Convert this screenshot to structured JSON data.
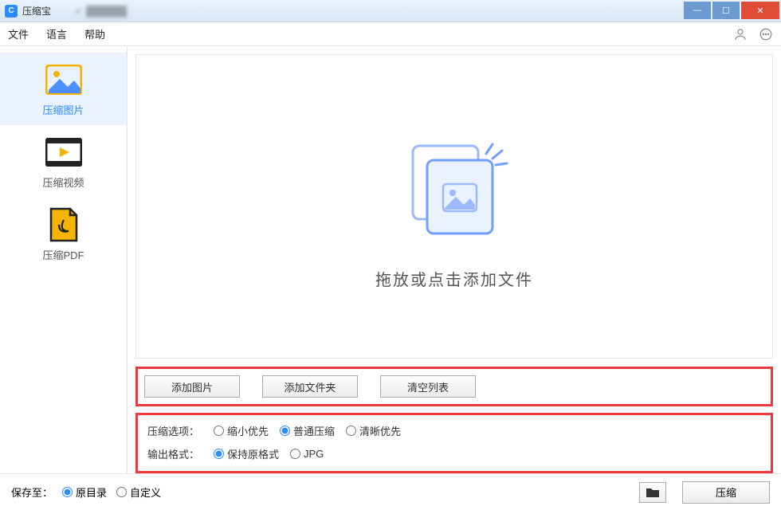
{
  "window": {
    "title": "压缩宝"
  },
  "menu": {
    "file": "文件",
    "language": "语言",
    "help": "帮助"
  },
  "sidebar": {
    "items": [
      {
        "label": "压缩图片"
      },
      {
        "label": "压缩视频"
      },
      {
        "label": "压缩PDF"
      }
    ]
  },
  "dropzone": {
    "text": "拖放或点击添加文件"
  },
  "actions": {
    "add_image": "添加图片",
    "add_folder": "添加文件夹",
    "clear_list": "清空列表"
  },
  "options": {
    "compress_label": "压缩选项：",
    "compress": {
      "shrink": "缩小优先",
      "normal": "普通压缩",
      "clarity": "清晰优先",
      "selected": "normal"
    },
    "format_label": "输出格式：",
    "format": {
      "keep": "保持原格式",
      "jpg": "JPG",
      "selected": "keep"
    }
  },
  "footer": {
    "save_to_label": "保存至：",
    "original_dir": "原目录",
    "custom": "自定义",
    "selected": "original",
    "compress_btn": "压缩"
  }
}
